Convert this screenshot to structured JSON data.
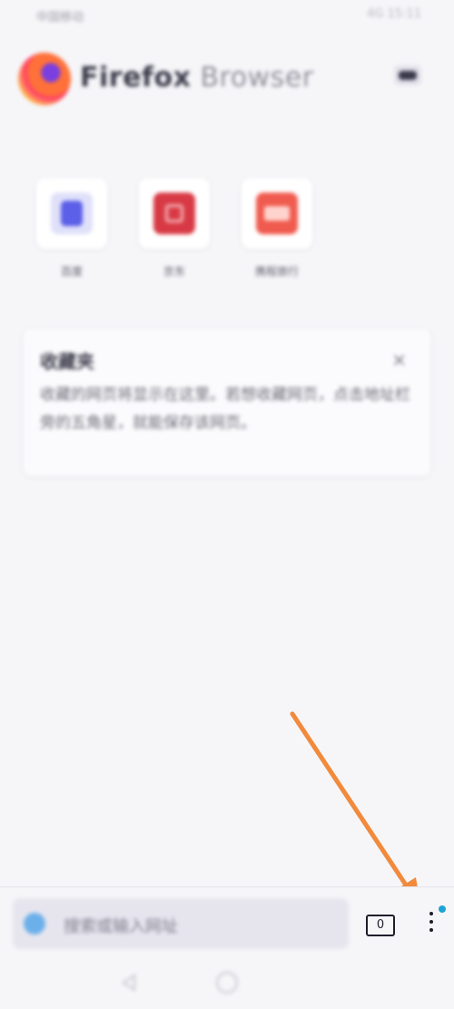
{
  "status_bar": {
    "left_text": "中国移动",
    "right_text": "4G 15:11"
  },
  "header": {
    "brand_bold": "Firefox",
    "brand_light": " Browser"
  },
  "shortcuts": [
    {
      "label": "百度",
      "icon": "baidu-icon",
      "color": "#5c5fe8"
    },
    {
      "label": "京东",
      "icon": "jd-icon",
      "color": "#d83a45"
    },
    {
      "label": "携程旅行",
      "icon": "ctrip-icon",
      "color": "#f05b4f"
    }
  ],
  "card": {
    "title": "收藏夹",
    "close": "×",
    "body": "收藏的网页将显示在这里。若想收藏网页，点击地址栏旁的五角星，就能保存该网页。"
  },
  "toolbar": {
    "search_placeholder": "搜索或输入网址",
    "tab_count": "0"
  },
  "annotation": {
    "arrow_color": "#f28a3c"
  }
}
